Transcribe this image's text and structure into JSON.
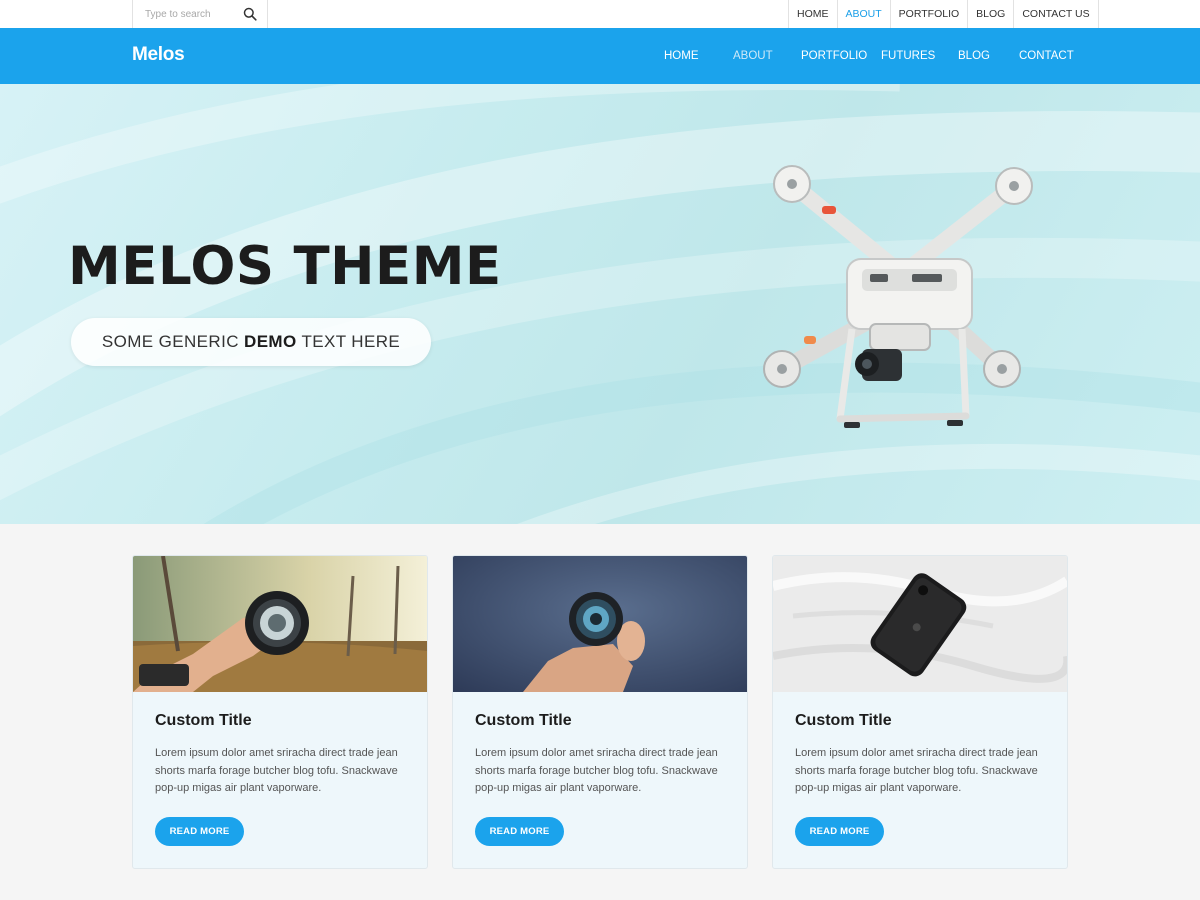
{
  "topbar": {
    "search_placeholder": "Type to search",
    "links": [
      {
        "label": "HOME"
      },
      {
        "label": "ABOUT"
      },
      {
        "label": "PORTFOLIO"
      },
      {
        "label": "BLOG"
      },
      {
        "label": "CONTACT US"
      }
    ]
  },
  "header": {
    "logo": "Melos",
    "nav": [
      {
        "label": "HOME"
      },
      {
        "label": "ABOUT"
      },
      {
        "label": "PORTFOLIO"
      },
      {
        "label": "FUTURES"
      },
      {
        "label": "BLOG"
      },
      {
        "label": "CONTACT"
      }
    ]
  },
  "hero": {
    "title": "MELOS THEME",
    "tagline_pre": "SOME GENERIC ",
    "tagline_bold": "DEMO",
    "tagline_post": " TEXT HERE"
  },
  "cards": [
    {
      "title": "Custom Title",
      "text": "Lorem ipsum dolor amet sriracha direct trade jean shorts marfa forage butcher blog tofu. Snackwave pop-up migas air plant vaporware.",
      "button": "READ MORE",
      "image": "camera-lens-photo"
    },
    {
      "title": "Custom Title",
      "text": "Lorem ipsum dolor amet sriracha direct trade jean shorts marfa forage butcher blog tofu. Snackwave pop-up migas air plant vaporware.",
      "button": "READ MORE",
      "image": "wristwatch-photo"
    },
    {
      "title": "Custom Title",
      "text": "Lorem ipsum dolor amet sriracha direct trade jean shorts marfa forage butcher blog tofu. Snackwave pop-up migas air plant vaporware.",
      "button": "READ MORE",
      "image": "smartphone-photo"
    }
  ],
  "colors": {
    "accent": "#1ba3ec",
    "active_link": "#1a9fe8",
    "hero_bg": "#c7ecef",
    "card_bg": "#eef7fb"
  },
  "icons": {
    "search": "search-icon"
  }
}
